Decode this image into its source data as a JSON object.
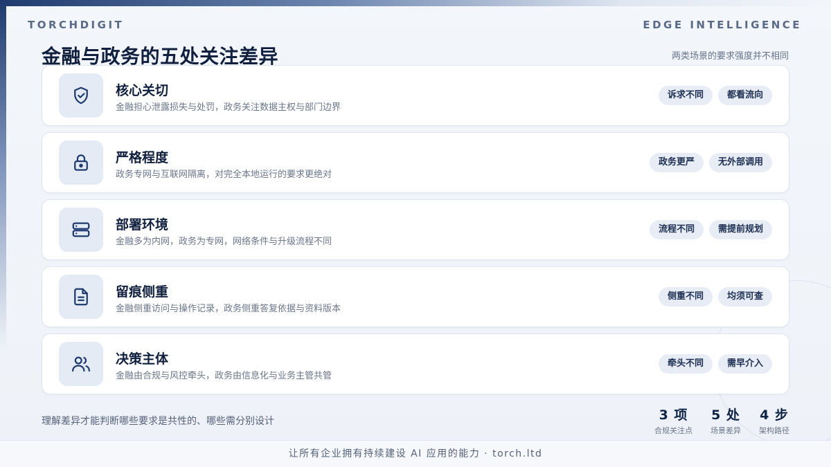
{
  "header": {
    "brand_left": "TORCHDIGIT",
    "brand_right": "EDGE INTELLIGENCE"
  },
  "title": "金融与政务的五处关注差异",
  "subtitle": "两类场景的要求强度并不相同",
  "cards": [
    {
      "icon": "shield-check-icon",
      "title": "核心关切",
      "desc": "金融担心泄露损失与处罚，政务关注数据主权与部门边界",
      "tags": [
        "诉求不同",
        "都看流向"
      ]
    },
    {
      "icon": "lock-icon",
      "title": "严格程度",
      "desc": "政务专网与互联网隔离，对完全本地运行的要求更绝对",
      "tags": [
        "政务更严",
        "无外部调用"
      ]
    },
    {
      "icon": "server-icon",
      "title": "部署环境",
      "desc": "金融多为内网，政务为专网，网络条件与升级流程不同",
      "tags": [
        "流程不同",
        "需提前规划"
      ]
    },
    {
      "icon": "document-icon",
      "title": "留痕侧重",
      "desc": "金融侧重访问与操作记录，政务侧重答复依据与资料版本",
      "tags": [
        "侧重不同",
        "均须可查"
      ]
    },
    {
      "icon": "users-icon",
      "title": "决策主体",
      "desc": "金融由合规与风控牵头，政务由信息化与业务主管共管",
      "tags": [
        "牵头不同",
        "需早介入"
      ]
    }
  ],
  "footer": {
    "note": "理解差异才能判断哪些要求是共性的、哪些需分别设计",
    "stats": [
      {
        "value": "3 项",
        "label": "合规关注点"
      },
      {
        "value": "5 处",
        "label": "场景差异"
      },
      {
        "value": "4 步",
        "label": "架构路径"
      }
    ],
    "tagline": "让所有企业拥有持续建设 AI 应用的能力 · torch.ltd"
  },
  "colors": {
    "accent": "#1f3a6e",
    "icon_bg": "#e4ebf5",
    "tag_bg": "#e8edf5"
  }
}
